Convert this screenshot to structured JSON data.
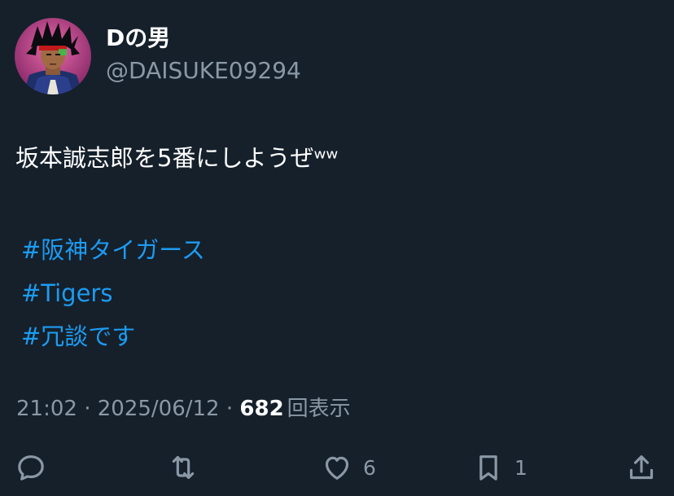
{
  "user": {
    "display_name": "Dの男",
    "handle": "@DAISUKE09294",
    "avatar_icon": "avatar-character-icon"
  },
  "tweet": {
    "text": "坂本誠志郎を5番にしようぜʷʷ",
    "hashtags": [
      "#阪神タイガース",
      "#Tigers",
      "#冗談です"
    ]
  },
  "meta": {
    "time": "21:02",
    "separator": " · ",
    "date": "2025/06/12",
    "views_count": "682",
    "views_label": "回表示"
  },
  "actions": {
    "reply": {
      "icon": "reply-icon",
      "count": ""
    },
    "retweet": {
      "icon": "retweet-icon",
      "count": ""
    },
    "like": {
      "icon": "heart-icon",
      "count": "6"
    },
    "bookmark": {
      "icon": "bookmark-icon",
      "count": "1"
    },
    "share": {
      "icon": "share-icon",
      "count": ""
    }
  },
  "colors": {
    "background": "#15202b",
    "text": "#ffffff",
    "secondary": "#8b98a5",
    "accent": "#1d9bf0"
  }
}
